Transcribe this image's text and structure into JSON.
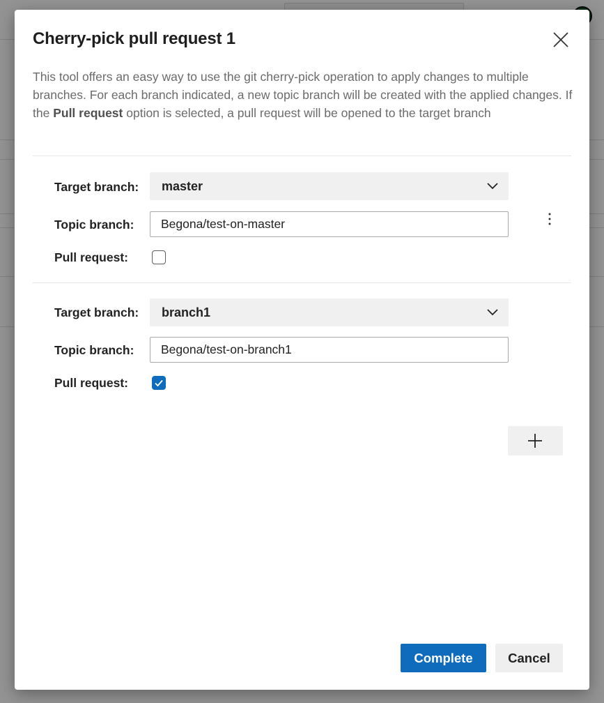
{
  "dialog": {
    "title": "Cherry-pick pull request 1",
    "description_parts": {
      "before": "This tool offers an easy way to use the git cherry-pick operation to apply changes to multiple branches. For each branch indicated, a new topic branch will be created with the applied changes. If the ",
      "bold": "Pull request",
      "after": " option is selected, a pull request will be opened to the target branch"
    },
    "labels": {
      "target_branch": "Target branch:",
      "topic_branch": "Topic branch:",
      "pull_request": "Pull request:"
    },
    "entries": [
      {
        "target_branch": "master",
        "topic_branch": "Begona/test-on-master",
        "pull_request": false
      },
      {
        "target_branch": "branch1",
        "topic_branch": "Begona/test-on-branch1",
        "pull_request": true
      }
    ],
    "buttons": {
      "complete": "Complete",
      "cancel": "Cancel"
    }
  },
  "icons": {
    "close": "close-icon",
    "more": "more-vertical-icon",
    "add": "plus-icon",
    "chevron": "chevron-down-icon",
    "check": "checkmark-icon"
  },
  "colors": {
    "primary": "#0f6cbd",
    "overlay": "rgba(0,0,0,0.42)"
  }
}
